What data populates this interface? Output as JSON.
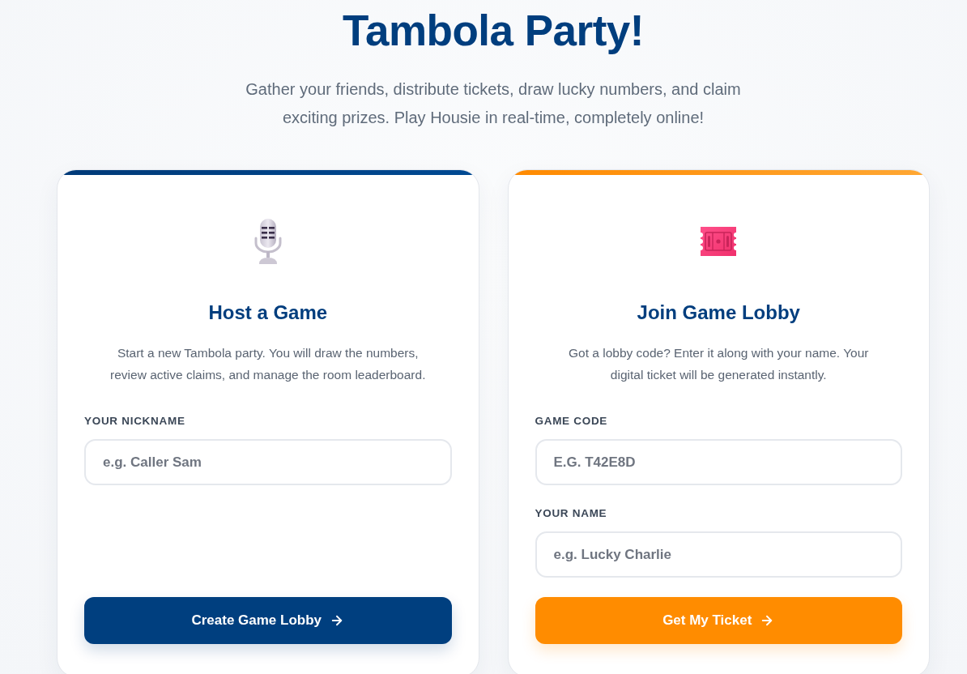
{
  "title": "Tambola Party!",
  "subtitle": "Gather your friends, distribute tickets, draw lucky numbers, and claim exciting prizes. Play Housie in real-time, completely online!",
  "cards": [
    {
      "kind": "host",
      "heading": "Host a Game",
      "description": "Start a new Tambola party. You will draw the numbers, review active claims, and manage the room leaderboard.",
      "fields": [
        {
          "label": "YOUR NICKNAME",
          "placeholder": "e.g. Caller Sam"
        }
      ],
      "button": "Create Game Lobby"
    },
    {
      "kind": "join",
      "heading": "Join Game Lobby",
      "description": "Got a lobby code? Enter it along with your name. Your digital ticket will be generated instantly.",
      "fields": [
        {
          "label": "GAME CODE",
          "placeholder": "E.G. T42E8D"
        },
        {
          "label": "YOUR NAME",
          "placeholder": "e.g. Lucky Charlie"
        }
      ],
      "button": "Get My Ticket"
    }
  ]
}
